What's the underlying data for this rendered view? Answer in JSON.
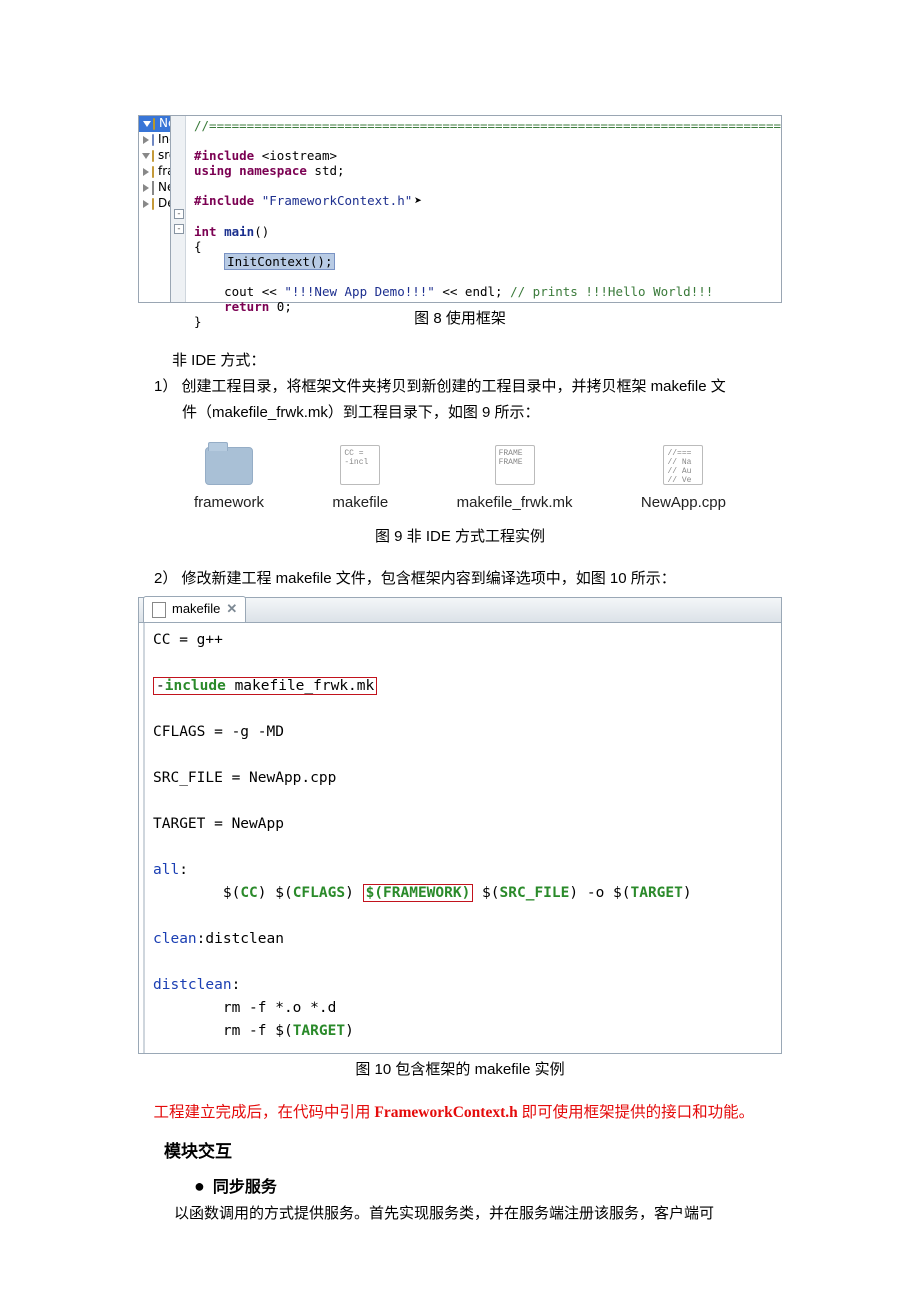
{
  "fig8": {
    "tree": {
      "project": "NewApp",
      "includes": "Includes",
      "src": "src",
      "framework": "framework",
      "newapp": "NewApp.cpp",
      "debug": "Debug"
    },
    "code": {
      "l1": "//============================================================================",
      "l3a": "#include",
      "l3b": " <iostream>",
      "l4a": "using",
      "l4b": " ",
      "l4c": "namespace",
      "l4d": " std;",
      "l6a": "#include",
      "l6b": " \"FrameworkContext.h\"",
      "l8a": "int",
      "l8b": " ",
      "l8c": "main",
      "l8d": "()",
      "l9": "{",
      "l10": "InitContext();",
      "l12a": "    cout << ",
      "l12b": "\"!!!New App Demo!!!\"",
      "l12c": " << endl; ",
      "l12d": "// prints !!!Hello World!!!",
      "l13a": "    ",
      "l13b": "return",
      "l13c": " 0;",
      "l14": "}"
    },
    "caption": "图 8 使用框架"
  },
  "text": {
    "non_ide": "非 IDE 方式：",
    "step1": "1） 创建工程目录，将框架文件夹拷贝到新创建的工程目录中，并拷贝框架 makefile 文",
    "step1b": "件（makefile_frwk.mk）到工程目录下，如图 9 所示：",
    "step2": "2） 修改新建工程 makefile 文件，包含框架内容到编译选项中，如图 10 所示："
  },
  "fig9": {
    "items": {
      "framework": "framework",
      "makefile": "makefile",
      "frwk": "makefile_frwk.mk",
      "newapp": "NewApp.cpp"
    },
    "iconText": {
      "makefile": "CC =\n-incl",
      "frwk": "FRAME\nFRAME",
      "newapp": "//===\n// Na\n// Au\n// Ve"
    },
    "caption": "图 9 非 IDE 方式工程实例"
  },
  "fig10": {
    "tab": "makefile",
    "code": {
      "l1": "CC = g++",
      "l2a": "-",
      "l2b": "include",
      "l2c": " makefile_frwk.mk",
      "l3": "CFLAGS = -g -MD",
      "l4": "SRC_FILE = NewApp.cpp",
      "l5": "TARGET = NewApp",
      "l6a": "all",
      "l6b": ":",
      "l7a": "        $(",
      "l7b": "CC",
      "l7c": ") $(",
      "l7d": "CFLAGS",
      "l7e": ") ",
      "l7box": "$(FRAMEWORK)",
      "l7f": " $(",
      "l7g": "SRC_FILE",
      "l7h": ") -o $(",
      "l7i": "TARGET",
      "l7j": ")",
      "l8a": "clean",
      "l8b": ":distclean",
      "l9a": "distclean",
      "l9b": ":",
      "l10": "        rm -f *.o *.d",
      "l11a": "        rm -f $(",
      "l11b": "TARGET",
      "l11c": ")"
    },
    "caption": "图 10 包含框架的 makefile 实例"
  },
  "rednote": {
    "pre": "工程建立完成后，在代码中引用 ",
    "bold": "FrameworkContext.h",
    "post": " 即可使用框架提供的接口和功能。"
  },
  "section": {
    "heading": "模块交互",
    "bullet": "同步服务",
    "last": "以函数调用的方式提供服务。首先实现服务类，并在服务端注册该服务，客户端可"
  }
}
